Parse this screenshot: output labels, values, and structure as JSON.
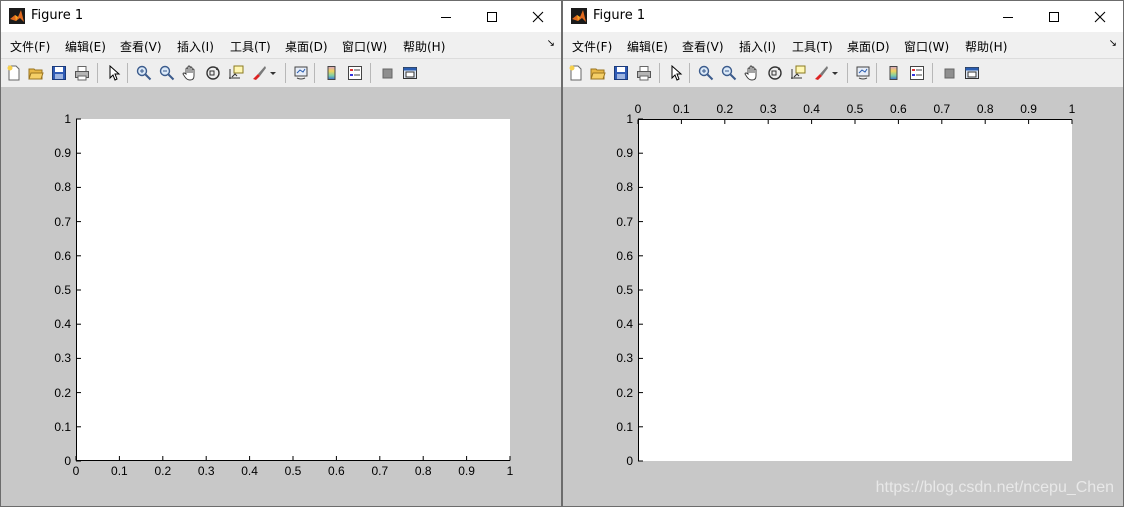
{
  "windows": [
    {
      "id": "left",
      "title": "Figure 1",
      "x_axis_location": "bottom",
      "menu": [
        "文件(F)",
        "编辑(E)",
        "查看(V)",
        "插入(I)",
        "工具(T)",
        "桌面(D)",
        "窗口(W)",
        "帮助(H)"
      ],
      "axes": {
        "xticks": [
          "0",
          "0.1",
          "0.2",
          "0.3",
          "0.4",
          "0.5",
          "0.6",
          "0.7",
          "0.8",
          "0.9",
          "1"
        ],
        "yticks": [
          "0",
          "0.1",
          "0.2",
          "0.3",
          "0.4",
          "0.5",
          "0.6",
          "0.7",
          "0.8",
          "0.9",
          "1"
        ]
      }
    },
    {
      "id": "right",
      "title": "Figure 1",
      "x_axis_location": "top",
      "menu": [
        "文件(F)",
        "编辑(E)",
        "查看(V)",
        "插入(I)",
        "工具(T)",
        "桌面(D)",
        "窗口(W)",
        "帮助(H)"
      ],
      "axes": {
        "xticks": [
          "0",
          "0.1",
          "0.2",
          "0.3",
          "0.4",
          "0.5",
          "0.6",
          "0.7",
          "0.8",
          "0.9",
          "1"
        ],
        "yticks": [
          "0",
          "0.1",
          "0.2",
          "0.3",
          "0.4",
          "0.5",
          "0.6",
          "0.7",
          "0.8",
          "0.9",
          "1"
        ]
      }
    }
  ],
  "toolbar_icons": [
    "new-figure-icon",
    "open-file-icon",
    "save-icon",
    "print-icon",
    "edit-plot-arrow-icon",
    "zoom-in-icon",
    "zoom-out-icon",
    "pan-hand-icon",
    "rotate-3d-icon",
    "data-cursor-icon",
    "brush-icon",
    "brush-dropdown-icon",
    "link-plot-icon",
    "colorbar-icon",
    "legend-icon",
    "hide-plot-tools-icon",
    "show-plot-tools-icon"
  ],
  "watermark": "https://blog.csdn.net/ncepu_Chen",
  "colors": {
    "title_bg": "#ffffff",
    "menu_bg": "#f0f0f0",
    "figure_bg": "#c8c8c8",
    "axes_bg": "#ffffff"
  }
}
